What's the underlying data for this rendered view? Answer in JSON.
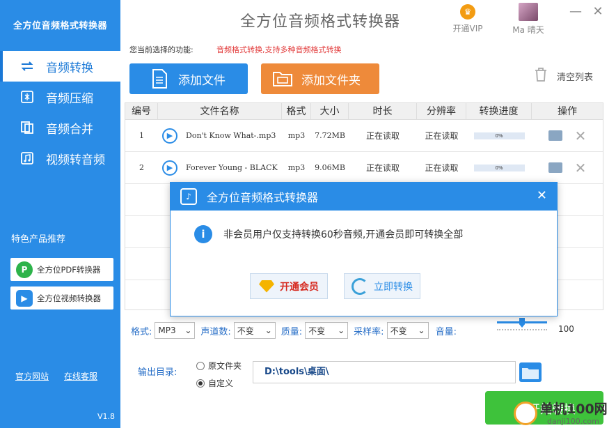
{
  "app": {
    "sidebar_title": "全方位音频格式转换器",
    "window_title": "全方位音频格式转换器",
    "vip_label": "开通VIP",
    "user_name": "Ma 晴天",
    "version": "V1.8"
  },
  "sidebar": {
    "items": [
      {
        "label": "音频转换",
        "icon": "convert-icon"
      },
      {
        "label": "音频压缩",
        "icon": "compress-icon"
      },
      {
        "label": "音频合并",
        "icon": "merge-icon"
      },
      {
        "label": "视频转音频",
        "icon": "video-audio-icon"
      }
    ],
    "promo_title": "特色产品推荐",
    "promos": [
      {
        "label": "全方位PDF转换器",
        "icon": "pdf-converter-icon",
        "color": "#2db34a"
      },
      {
        "label": "全方位视频转换器",
        "icon": "video-converter-icon",
        "color": "#2a8ce6"
      }
    ],
    "links": [
      "官方网站",
      "在线客服"
    ]
  },
  "main": {
    "func_label": "您当前选择的功能:",
    "func_value": "音频格式转换,支持多种音频格式转换",
    "add_file": "添加文件",
    "add_folder": "添加文件夹",
    "clear_list": "清空列表",
    "colors": {
      "primary": "#2a8ce6",
      "orange": "#ee8a3a",
      "green": "#3ec23b",
      "red": "#e23b3b"
    }
  },
  "table": {
    "headers": [
      "编号",
      "文件名称",
      "格式",
      "大小",
      "时长",
      "分辨率",
      "转换进度",
      "操作"
    ],
    "rows": [
      {
        "no": "1",
        "name": "Don't Know What-.mp3",
        "format": "mp3",
        "size": "7.72MB",
        "duration": "正在读取",
        "resolution": "正在读取",
        "progress": "0%",
        "progress_value": 0
      },
      {
        "no": "2",
        "name": "Forever Young - BLACK",
        "format": "mp3",
        "size": "9.06MB",
        "duration": "正在读取",
        "resolution": "正在读取",
        "progress": "0%",
        "progress_value": 0
      }
    ]
  },
  "options": {
    "format_label": "格式:",
    "format_value": "MP3",
    "channel_label": "声道数:",
    "channel_value": "不变",
    "quality_label": "质量:",
    "quality_value": "不变",
    "samplerate_label": "采样率:",
    "samplerate_value": "不变",
    "volume_label": "音量:",
    "volume_value": "100",
    "volume_level": 0.5
  },
  "output": {
    "label": "输出目录:",
    "radio_original": "原文件夹",
    "radio_custom": "自定义",
    "path": "D:\\tools\\桌面\\",
    "start_label": "开始转换"
  },
  "modal": {
    "title": "全方位音频格式转换器",
    "message": "非会员用户仅支持转换60秒音频,开通会员即可转换全部",
    "btn_vip": "开通会员",
    "btn_convert": "立即转换"
  },
  "watermark": {
    "text": "单机100网",
    "sub": "danji100.com"
  }
}
